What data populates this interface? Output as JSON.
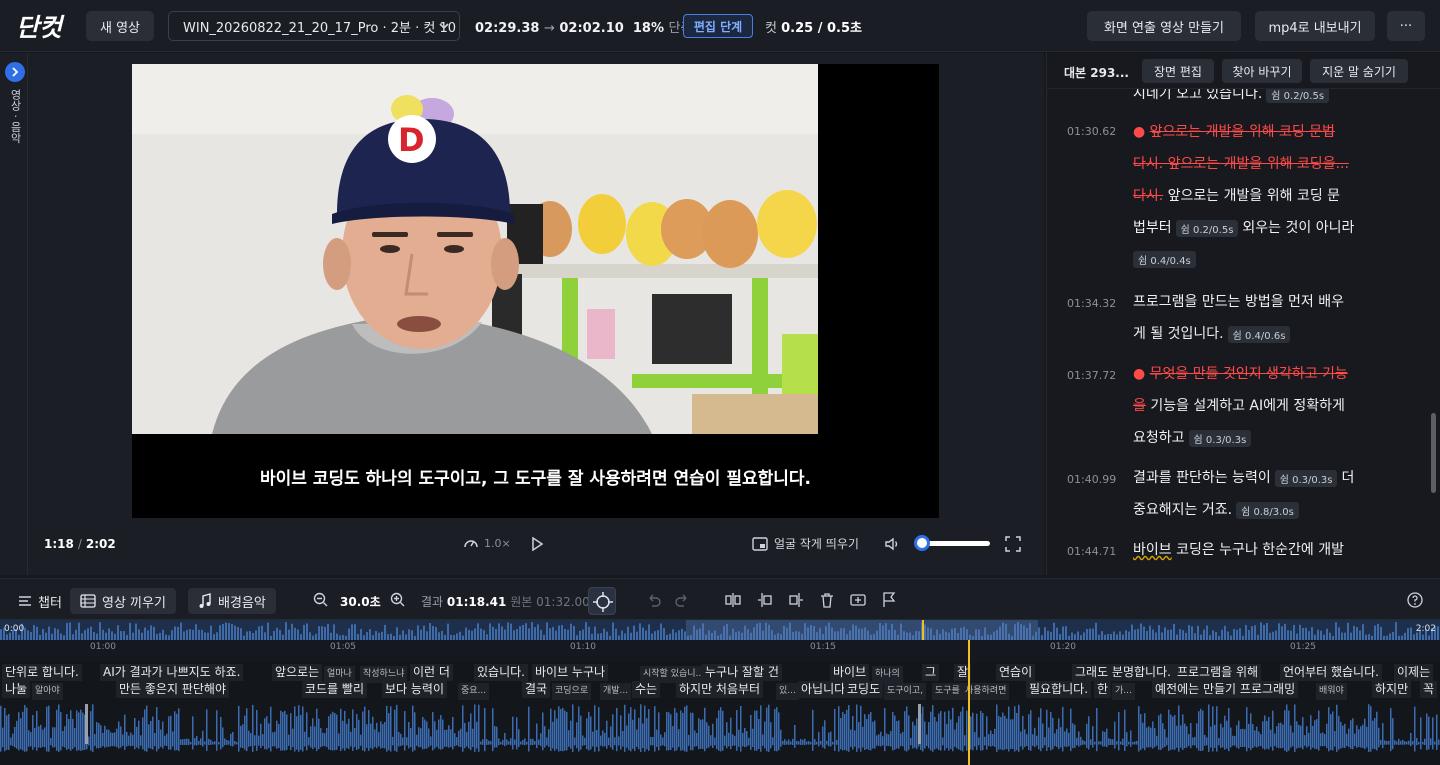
{
  "topbar": {
    "logo_text": "단컷",
    "new_video_label": "새 영상",
    "file_label": "WIN_20260822_21_20_17_Pro · 2분 · 컷 10",
    "time_from": "02:29.38",
    "time_arrow": "→",
    "time_to": "02:02.10",
    "reduction_pct": "18%",
    "reduction_label": "단축",
    "stage_badge": "편집 단계",
    "cut_label": "컷",
    "cut_value": "0.25 / 0.5초",
    "make_presentation_label": "화면 연출 영상 만들기",
    "export_label": "mp4로 내보내기",
    "more_label": "···"
  },
  "leftrail": {
    "label": "영상 · 음악"
  },
  "video": {
    "subtitle": "바이브 코딩도 하나의 도구이고, 그 도구를 잘 사용하려면 연습이 필요합니다.",
    "current_time": "1:18",
    "total_time": "2:02",
    "speed": "1.0×",
    "pip_label": "얼굴 작게 띄우기",
    "volume_level": 0.1
  },
  "script": {
    "title": "대본 293...",
    "scene_edit_label": "장면 편집",
    "find_replace_label": "찾아 바꾸기",
    "hide_deleted_label": "지운 말 숨기기",
    "entries": [
      {
        "ts": "",
        "lines": [
          {
            "t": "시네기   오고   있습니다.",
            "pill": "쉼 0.2/0.5s"
          }
        ]
      },
      {
        "ts": "01:30.62",
        "lines": [
          {
            "dot": "●",
            "del": "앞으로는   개발을   위해   코딩   문법"
          },
          {
            "del": "다시.   앞으로는   개발을   위해   코딩을..."
          },
          {
            "del": "다시.",
            "t": "  앞으로는   개발을   위해   코딩   문"
          },
          {
            "t": "법부터",
            "pill": "쉼 0.2/0.5s",
            "t2": "외우는   것이   아니라"
          },
          {
            "pill": "쉼 0.4/0.4s"
          }
        ]
      },
      {
        "ts": "01:34.32",
        "lines": [
          {
            "t": "프로그램을   만드는   방법을   먼저   배우"
          },
          {
            "t": "게   될   것입니다.",
            "pill": "쉼 0.4/0.6s"
          }
        ]
      },
      {
        "ts": "01:37.72",
        "lines": [
          {
            "dot": "●",
            "del": "무엇을   만들   것인지   생각하고   기능"
          },
          {
            "del": "을",
            "t": "   기능을   설계하고   AI에게   정확하게"
          },
          {
            "t": "요청하고",
            "pill": "쉼 0.3/0.3s"
          }
        ]
      },
      {
        "ts": "01:40.99",
        "lines": [
          {
            "t": "결과를   판단하는   능력이",
            "pill": "쉼 0.3/0.3s",
            "t2": "더"
          },
          {
            "t": "중요해지는   거죠.",
            "pill": "쉼 0.8/3.0s"
          }
        ]
      },
      {
        "ts": "01:44.71",
        "lines": [
          {
            "wavy": "바이브",
            "t": "   코딩은   누구나   한순간에   개발"
          }
        ]
      }
    ]
  },
  "timeline_toolbar": {
    "chapter_label": "챕터",
    "broll_label": "영상 끼우기",
    "bgm_label": "배경음악",
    "zoom_value": "30.0초",
    "result_label": "결과",
    "result_value": "01:18.41",
    "original_label": "원본",
    "original_value": "01:32.00"
  },
  "timeline": {
    "start_label": "0:00",
    "end_label": "2:02",
    "ticks": [
      "01:00",
      "01:05",
      "01:10",
      "01:15",
      "01:20",
      "01:25"
    ],
    "row1": [
      "단위로 합니다.",
      "AI가 결과가 나쁘지도 하죠.",
      "앞으로는",
      "얼마나",
      "작성하느냐",
      "이런 더",
      "있습니다.",
      "바이브 누구나",
      "시작할 있습니...",
      "누구나 잘할 건",
      "바이브",
      "하나의",
      "그",
      "잘",
      "연습이",
      "그래도 분명합니다.",
      "프로그램을 위해",
      "언어부터 했습니다.",
      "이제는"
    ],
    "row2": [
      "나눌",
      "알아야",
      "만든 좋은지 판단해야",
      "코드를 빨리",
      "보다 능력이",
      "중요...",
      "결국",
      "코딩으로",
      "개발...",
      "수는",
      "하지만 처음부터",
      "있...",
      "아닙니다.",
      "코딩도",
      "도구이고,",
      "도구를",
      "사용하려면",
      "필요합니다.",
      "한",
      "가...",
      "예전에는 만들기 프로그래밍",
      "배워야",
      "하지만",
      "꼭"
    ]
  }
}
